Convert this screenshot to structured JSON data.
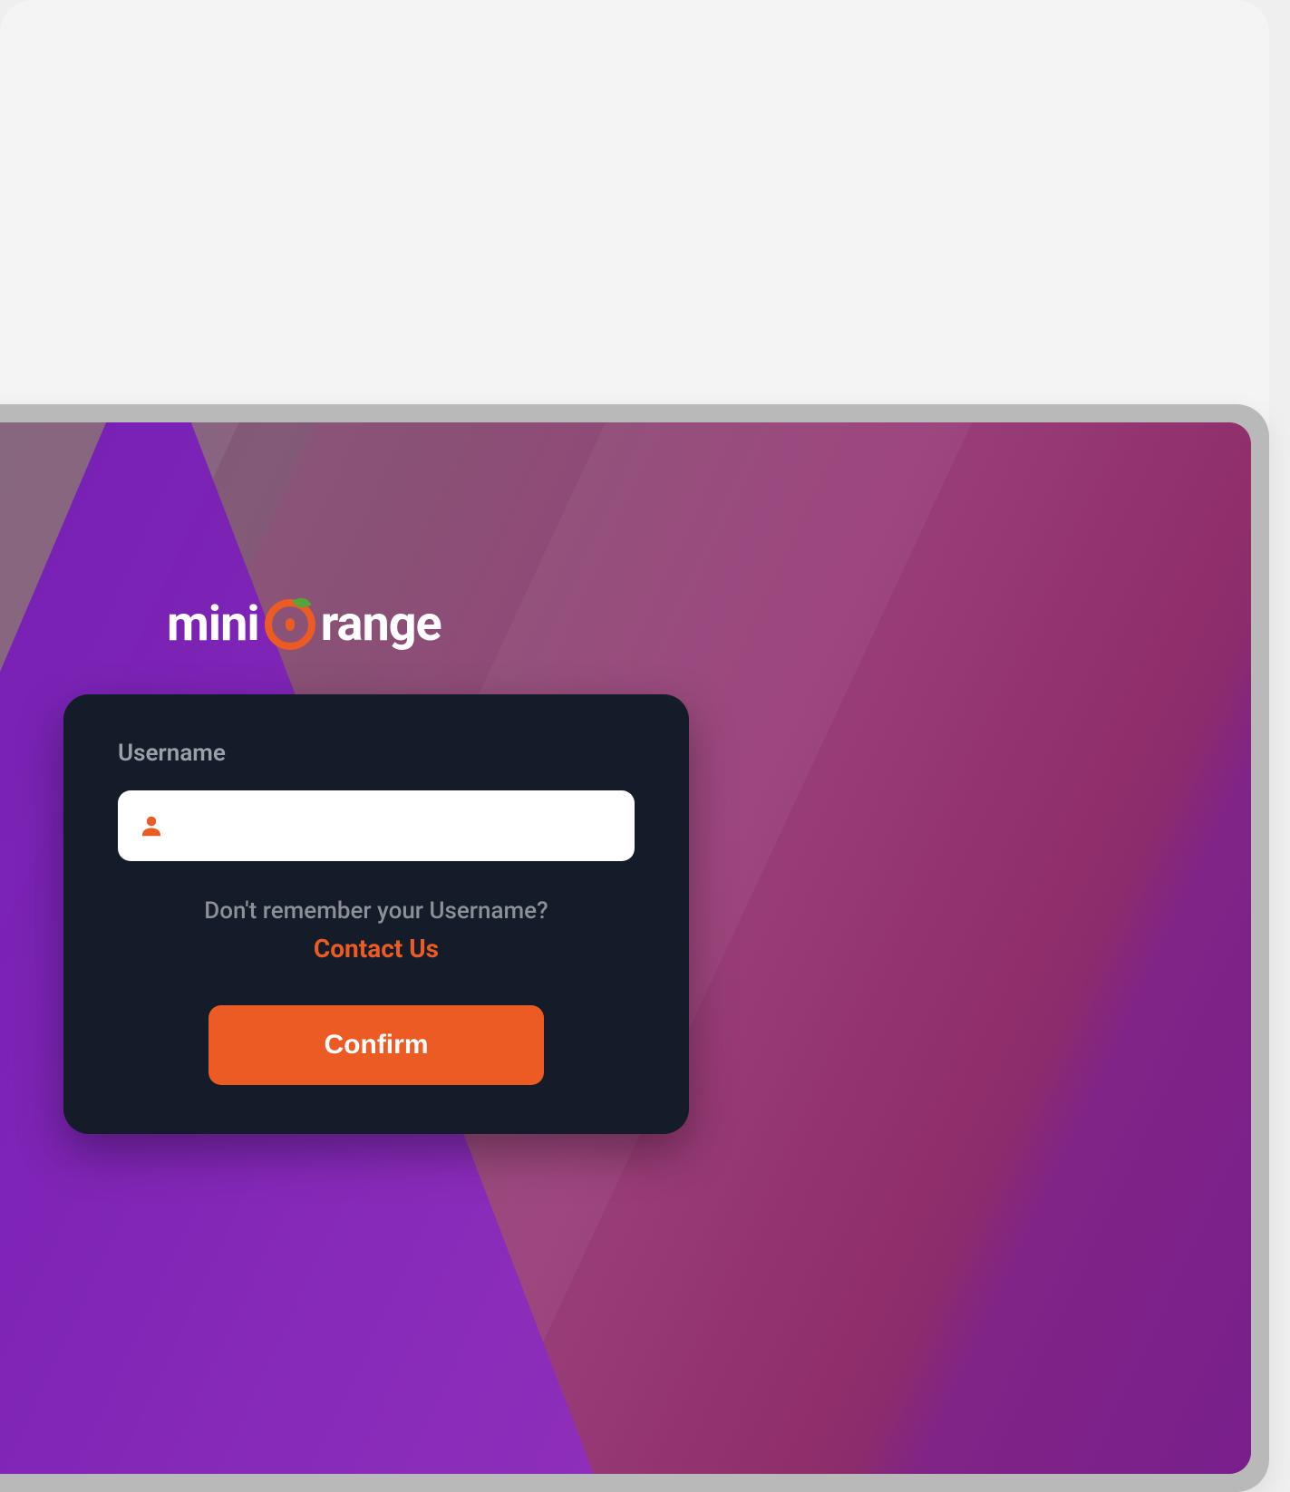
{
  "brand": {
    "name_left": "mini",
    "name_right": "range",
    "accent_color": "#ec5b23"
  },
  "login": {
    "username_label": "Username",
    "username_value": "",
    "username_placeholder": "",
    "help_text": "Don't remember your Username?",
    "contact_link_label": "Contact Us",
    "confirm_label": "Confirm"
  }
}
